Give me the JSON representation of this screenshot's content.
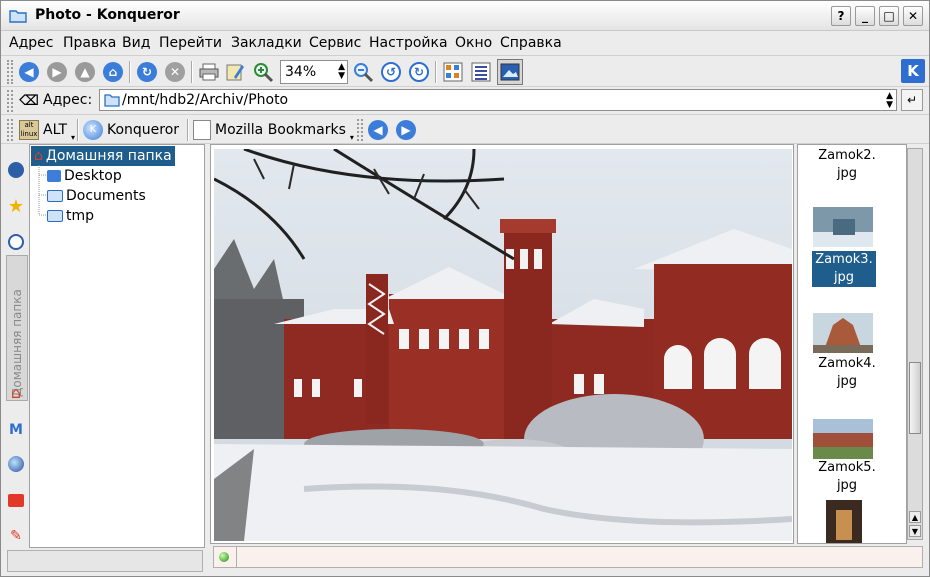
{
  "window": {
    "title": "Photo - Konqueror",
    "controls": [
      "?",
      "_",
      "□",
      "✕"
    ]
  },
  "menu": [
    "Адрес",
    "Правка",
    "Вид",
    "Перейти",
    "Закладки",
    "Сервис",
    "Настройка",
    "Окно",
    "Справка"
  ],
  "toolbar": {
    "zoom_value": "34%",
    "icons": [
      "back-icon",
      "forward-icon",
      "up-icon",
      "home-icon",
      "reload-icon",
      "stop-icon",
      "print-icon",
      "properties-icon",
      "zoom-in-icon",
      "zoom-out-icon",
      "rotate-left-icon",
      "rotate-right-icon",
      "icon-view-icon",
      "detailed-view-icon",
      "image-view-icon",
      "kde-logo-icon"
    ]
  },
  "location": {
    "label": "Адрес:",
    "url": "/mnt/hdb2/Archiv/Photo"
  },
  "bookmarks": [
    {
      "label": "ALT",
      "icon": "alt-linux-icon"
    },
    {
      "label": "Konqueror",
      "icon": "konqueror-icon"
    },
    {
      "label": "Mozilla Bookmarks",
      "icon": "bookmark-folder-icon"
    }
  ],
  "sidebar": {
    "tab_label": "Домашняя папка",
    "tree": [
      {
        "label": "Домашняя папка",
        "selected": true
      },
      {
        "label": "Desktop",
        "selected": false
      },
      {
        "label": "Documents",
        "selected": false
      },
      {
        "label": "tmp",
        "selected": false
      }
    ]
  },
  "thumbnails": [
    {
      "label1": "Zamok2.",
      "label2": "jpg",
      "selected": false
    },
    {
      "label1": "Zamok3.",
      "label2": "jpg",
      "selected": true
    },
    {
      "label1": "Zamok4.",
      "label2": "jpg",
      "selected": false
    },
    {
      "label1": "Zamok5.",
      "label2": "jpg",
      "selected": false
    }
  ],
  "colors": {
    "selection": "#1f5e8c",
    "brick": "#8e2a22",
    "snow": "#eef0f4"
  }
}
